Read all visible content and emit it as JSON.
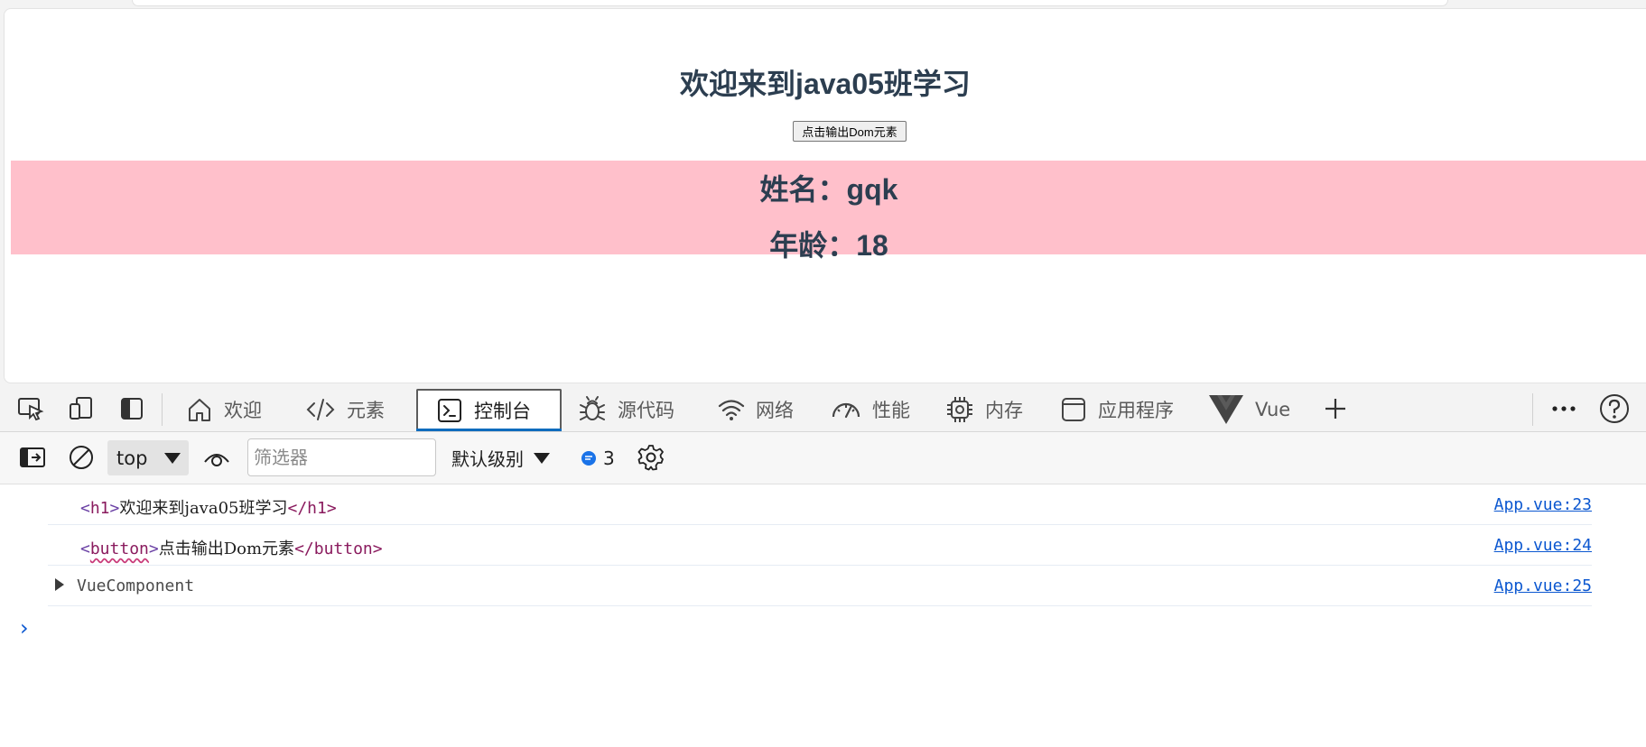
{
  "page": {
    "title": "欢迎来到java05班学习",
    "button_label": "点击输出Dom元素",
    "name_line": "姓名：gqk",
    "age_line": "年龄：18"
  },
  "devtools": {
    "tabs": [
      {
        "label": "欢迎",
        "icon": "home-icon"
      },
      {
        "label": "元素",
        "icon": "code-icon"
      },
      {
        "label": "控制台",
        "icon": "console-icon",
        "active": true
      },
      {
        "label": "源代码",
        "icon": "bug-icon"
      },
      {
        "label": "网络",
        "icon": "wifi-icon"
      },
      {
        "label": "性能",
        "icon": "gauge-icon"
      },
      {
        "label": "内存",
        "icon": "chip-icon"
      },
      {
        "label": "应用程序",
        "icon": "app-window-icon"
      },
      {
        "label": "Vue",
        "icon": "vue-logo-icon"
      }
    ],
    "accent_color": "#0f6cbd"
  },
  "console_toolbar": {
    "context": "top",
    "filter_placeholder": "筛选器",
    "levels_label": "默认级别",
    "message_count": "3"
  },
  "console": {
    "rows": [
      {
        "open_tag": "<",
        "tag": "h1",
        "close_open": ">",
        "text": "欢迎来到java05班学习",
        "end_tag": "</h1>",
        "source": "App.vue:23"
      },
      {
        "open_tag": "<",
        "tag": "button",
        "close_open": ">",
        "text": "点击输出Dom元素",
        "end_tag": "</button>",
        "source": "App.vue:24"
      },
      {
        "object": "VueComponent",
        "source": "App.vue:25"
      }
    ],
    "prompt": "›"
  }
}
